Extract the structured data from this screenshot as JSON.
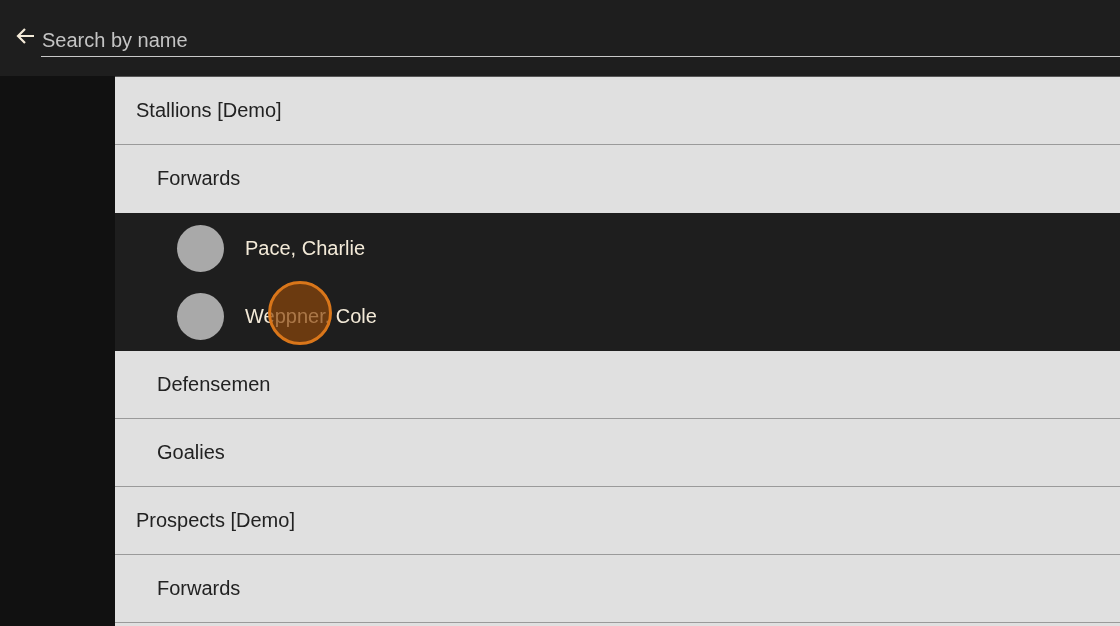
{
  "search": {
    "placeholder": "Search by name"
  },
  "teams": [
    {
      "name": "Stallions [Demo]",
      "children": [
        {
          "name": "Forwards",
          "expanded": true,
          "children": [
            {
              "name": "Pace, Charlie",
              "touched": false
            },
            {
              "name": "Weppner, Cole",
              "touched": true
            }
          ]
        },
        {
          "name": "Defensemen",
          "expanded": false
        },
        {
          "name": "Goalies",
          "expanded": false
        }
      ]
    },
    {
      "name": "Prospects [Demo]",
      "children": [
        {
          "name": "Forwards",
          "expanded": false
        }
      ]
    }
  ]
}
